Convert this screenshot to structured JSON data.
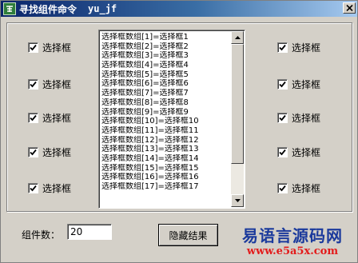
{
  "window": {
    "title": "寻找组件命令",
    "user": "yu_jf"
  },
  "checkbox_label": "选择框",
  "checkboxes_left": [
    {
      "label": "选择框",
      "checked": true
    },
    {
      "label": "选择框",
      "checked": true
    },
    {
      "label": "选择框",
      "checked": true
    },
    {
      "label": "选择框",
      "checked": true
    },
    {
      "label": "选择框",
      "checked": true
    }
  ],
  "checkboxes_right": [
    {
      "label": "选择框",
      "checked": true
    },
    {
      "label": "选择框",
      "checked": true
    },
    {
      "label": "选择框",
      "checked": true
    },
    {
      "label": "选择框",
      "checked": true
    },
    {
      "label": "选择框",
      "checked": true
    }
  ],
  "list": {
    "items": [
      "选择框数组[1]=选择框1",
      "选择框数组[2]=选择框2",
      "选择框数组[3]=选择框3",
      "选择框数组[4]=选择框4",
      "选择框数组[5]=选择框5",
      "选择框数组[6]=选择框6",
      "选择框数组[7]=选择框7",
      "选择框数组[8]=选择框8",
      "选择框数组[9]=选择框9",
      "选择框数组[10]=选择框10",
      "选择框数组[11]=选择框11",
      "选择框数组[12]=选择框12",
      "选择框数组[13]=选择框13",
      "选择框数组[14]=选择框14",
      "选择框数组[15]=选择框15",
      "选择框数组[16]=选择框16",
      "选择框数组[17]=选择框17"
    ]
  },
  "footer": {
    "count_label": "组件数：",
    "count_value": "20",
    "hide_button": "隐藏结果"
  },
  "watermark": {
    "name": "易语言源码网",
    "url": "www.e5a5x.com"
  },
  "colors": {
    "title_gradient_start": "#0a246a",
    "title_gradient_end": "#a6caf0",
    "face": "#d4d0c8",
    "watermark_blue": "#1b3a9c",
    "watermark_red": "#e31b1b"
  }
}
